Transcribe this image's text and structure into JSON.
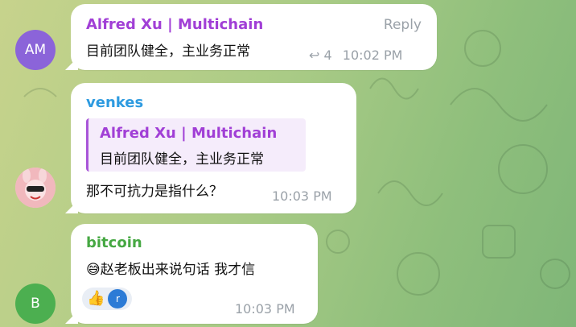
{
  "messages": [
    {
      "sender": "Alfred Xu | Multichain",
      "avatar_text": "AM",
      "text": "目前团队健全，主业务正常",
      "reply_label": "Reply",
      "reply_count": "4",
      "time": "10:02 PM"
    },
    {
      "sender": "venkes",
      "quote_sender": "Alfred Xu | Multichain",
      "quote_text": "目前团队健全，主业务正常",
      "text": "那不可抗力是指什么？",
      "time": "10:03 PM"
    },
    {
      "sender": "bitcoin",
      "avatar_text": "B",
      "text": "😅赵老板出来说句话 我才信",
      "reaction_emoji": "👍",
      "reaction_user": "r",
      "time": "10:03 PM"
    }
  ],
  "colors": {
    "alfred_name": "#a13fd6",
    "venkes_name": "#2e9be0",
    "bitcoin_name": "#46a843",
    "avatar_am": "#8b64d9",
    "avatar_b": "#4caf50"
  }
}
